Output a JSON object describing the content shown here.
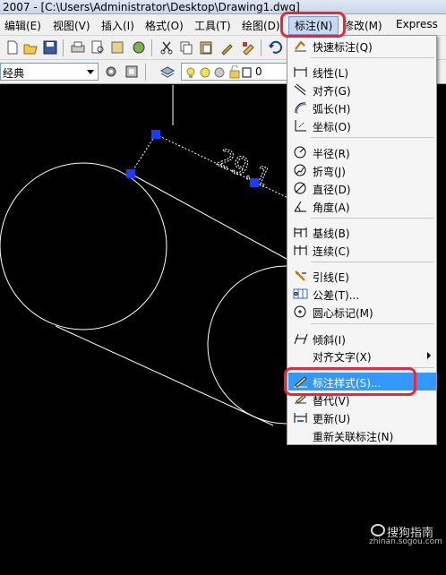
{
  "window": {
    "title": "2007 - [C:\\Users\\Administrator\\Desktop\\Drawing1.dwg]"
  },
  "menubar": {
    "items": [
      {
        "label": "编辑(E)"
      },
      {
        "label": "视图(V)"
      },
      {
        "label": "插入(I)"
      },
      {
        "label": "格式(O)"
      },
      {
        "label": "工具(T)"
      },
      {
        "label": "绘图(D)"
      },
      {
        "label": "标注(N)"
      },
      {
        "label": "修改(M)"
      },
      {
        "label": "Express"
      }
    ]
  },
  "toolbar": {
    "workspace_value": "经典",
    "layer_value": "0"
  },
  "dim_menu": {
    "items": [
      {
        "label": "快速标注(Q)",
        "icon": "quick-dimension-icon"
      },
      {
        "label": "线性(L)",
        "icon": "linear-dimension-icon"
      },
      {
        "label": "对齐(G)",
        "icon": "aligned-dimension-icon"
      },
      {
        "label": "弧长(H)",
        "icon": "arc-length-icon"
      },
      {
        "label": "坐标(O)",
        "icon": "ordinate-icon"
      },
      {
        "label": "半径(R)",
        "icon": "radius-icon"
      },
      {
        "label": "折弯(J)",
        "icon": "jogged-icon"
      },
      {
        "label": "直径(D)",
        "icon": "diameter-icon"
      },
      {
        "label": "角度(A)",
        "icon": "angular-icon"
      },
      {
        "label": "基线(B)",
        "icon": "baseline-icon"
      },
      {
        "label": "连续(C)",
        "icon": "continue-icon"
      },
      {
        "label": "引线(E)",
        "icon": "leader-icon"
      },
      {
        "label": "公差(T)...",
        "icon": "tolerance-icon"
      },
      {
        "label": "圆心标记(M)",
        "icon": "center-mark-icon"
      },
      {
        "label": "倾斜(I)",
        "icon": "oblique-icon"
      },
      {
        "label": "对齐文字(X)",
        "icon": ""
      },
      {
        "label": "标注样式(S)...",
        "icon": "dimension-style-icon"
      },
      {
        "label": "替代(V)",
        "icon": "override-icon"
      },
      {
        "label": "更新(U)",
        "icon": "update-icon"
      },
      {
        "label": "重新关联标注(N)",
        "icon": ""
      }
    ]
  },
  "drawing": {
    "dimension_text": "29.1"
  },
  "watermark": {
    "name": "搜狗指南",
    "url": "zhinan.sogou.com"
  },
  "colors": {
    "highlight": "#3399ff",
    "annotation": "#e8283a",
    "grip": "#1a3cff"
  }
}
